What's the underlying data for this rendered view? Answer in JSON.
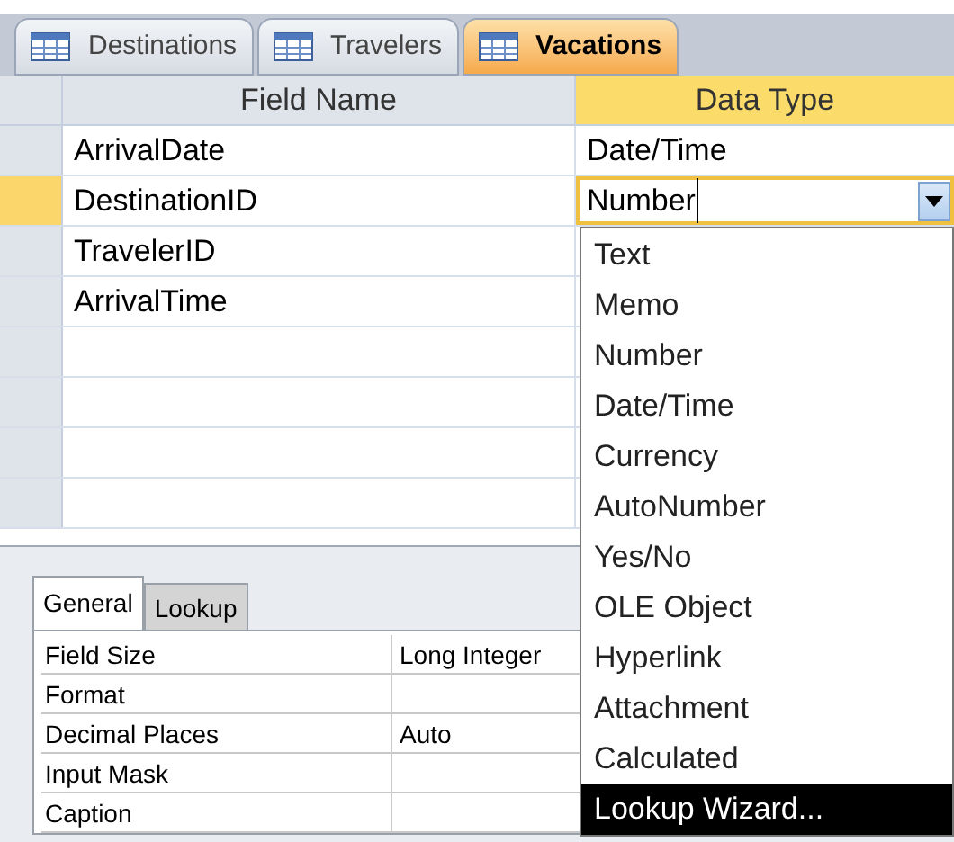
{
  "tabs": [
    {
      "label": "Destinations",
      "selected": false
    },
    {
      "label": "Travelers",
      "selected": false
    },
    {
      "label": "Vacations",
      "selected": true
    }
  ],
  "grid": {
    "columns": [
      "Field Name",
      "Data Type"
    ],
    "rows": [
      {
        "field_name": "ArrivalDate",
        "data_type": "Date/Time",
        "selected": false
      },
      {
        "field_name": "DestinationID",
        "data_type": "Number",
        "selected": true
      },
      {
        "field_name": "TravelerID",
        "data_type": "",
        "selected": false
      },
      {
        "field_name": "ArrivalTime",
        "data_type": "",
        "selected": false
      }
    ]
  },
  "dropdown": {
    "items": [
      {
        "label": "Text",
        "selected": false
      },
      {
        "label": "Memo",
        "selected": false
      },
      {
        "label": "Number",
        "selected": false
      },
      {
        "label": "Date/Time",
        "selected": false
      },
      {
        "label": "Currency",
        "selected": false
      },
      {
        "label": "AutoNumber",
        "selected": false
      },
      {
        "label": "Yes/No",
        "selected": false
      },
      {
        "label": "OLE Object",
        "selected": false
      },
      {
        "label": "Hyperlink",
        "selected": false
      },
      {
        "label": "Attachment",
        "selected": false
      },
      {
        "label": "Calculated",
        "selected": false
      },
      {
        "label": "Lookup Wizard...",
        "selected": true
      }
    ]
  },
  "properties": {
    "tabs": [
      {
        "label": "General",
        "selected": true
      },
      {
        "label": "Lookup",
        "selected": false
      }
    ],
    "rows": [
      {
        "name": "Field Size",
        "value": "Long Integer"
      },
      {
        "name": "Format",
        "value": ""
      },
      {
        "name": "Decimal Places",
        "value": "Auto"
      },
      {
        "name": "Input Mask",
        "value": ""
      },
      {
        "name": "Caption",
        "value": ""
      }
    ]
  }
}
